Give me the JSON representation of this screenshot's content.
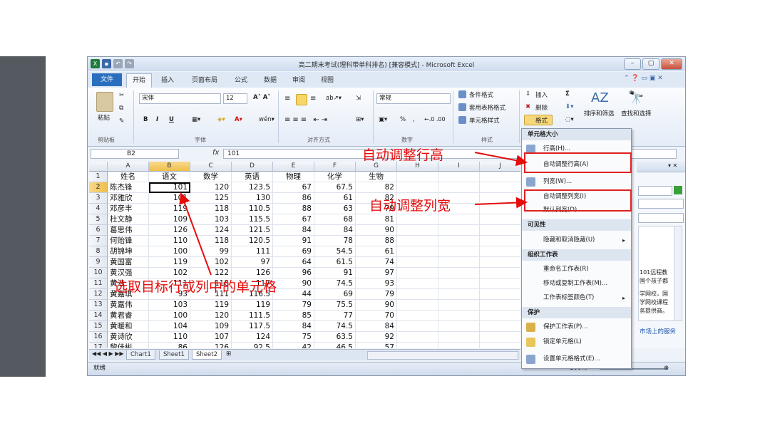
{
  "window": {
    "title": "高二期末考试(理科带单科排名) [兼容模式] - Microsoft Excel"
  },
  "tabs": [
    "文件",
    "开始",
    "插入",
    "页面布局",
    "公式",
    "数据",
    "审阅",
    "视图"
  ],
  "ribbon": {
    "clipboard": {
      "label": "剪贴板",
      "paste": "粘贴"
    },
    "font": {
      "label": "字体",
      "name": "宋体",
      "size": "12",
      "bold": "B",
      "italic": "I",
      "underline": "U"
    },
    "alignment": {
      "label": "对齐方式"
    },
    "number": {
      "label": "数字",
      "format": "常规",
      "percent": "%",
      "comma": ","
    },
    "styles": {
      "label": "样式",
      "conditional": "条件格式",
      "table": "套用表格格式",
      "cell": "单元格样式"
    },
    "cells": {
      "insert": "插入",
      "delete": "删除",
      "format": "格式"
    },
    "editing": {
      "sort": "排序和筛选",
      "find": "查找和选择",
      "sigma": "Σ"
    }
  },
  "formula_bar": {
    "name_box": "B2",
    "fx": "fx",
    "content": "101"
  },
  "columns": [
    "A",
    "B",
    "C",
    "D",
    "E",
    "F",
    "G",
    "H",
    "I",
    "J"
  ],
  "rows": [
    {
      "n": "1",
      "cells": [
        "姓名",
        "语文",
        "数学",
        "英语",
        "物理",
        "化学",
        "生物"
      ]
    },
    {
      "n": "2",
      "cells": [
        "陈杰锋",
        "101",
        "120",
        "123.5",
        "67",
        "67.5",
        "82"
      ]
    },
    {
      "n": "3",
      "cells": [
        "邓雅欣",
        "101",
        "125",
        "130",
        "86",
        "61",
        "82"
      ]
    },
    {
      "n": "4",
      "cells": [
        "邓彦丰",
        "119",
        "118",
        "110.5",
        "88",
        "63",
        "79"
      ]
    },
    {
      "n": "5",
      "cells": [
        "杜文静",
        "109",
        "103",
        "115.5",
        "67",
        "68",
        "81"
      ]
    },
    {
      "n": "6",
      "cells": [
        "葛思伟",
        "126",
        "124",
        "121.5",
        "84",
        "84",
        "90"
      ]
    },
    {
      "n": "7",
      "cells": [
        "何贻锋",
        "110",
        "118",
        "120.5",
        "91",
        "78",
        "88"
      ]
    },
    {
      "n": "8",
      "cells": [
        "胡锦坤",
        "100",
        "99",
        "111",
        "69",
        "54.5",
        "61"
      ]
    },
    {
      "n": "9",
      "cells": [
        "黄国富",
        "119",
        "102",
        "97",
        "64",
        "61.5",
        "74"
      ]
    },
    {
      "n": "10",
      "cells": [
        "黄汉强",
        "102",
        "122",
        "126",
        "96",
        "91",
        "97"
      ]
    },
    {
      "n": "11",
      "cells": [
        "黄浩",
        "111",
        "118",
        "117",
        "90",
        "74.5",
        "93"
      ]
    },
    {
      "n": "12",
      "cells": [
        "黄嘉琪",
        "93",
        "111",
        "116.5",
        "44",
        "69",
        "79"
      ]
    },
    {
      "n": "13",
      "cells": [
        "黄嘉伟",
        "103",
        "119",
        "119",
        "79",
        "75.5",
        "90"
      ]
    },
    {
      "n": "14",
      "cells": [
        "黄君睿",
        "100",
        "120",
        "111.5",
        "85",
        "77",
        "70"
      ]
    },
    {
      "n": "15",
      "cells": [
        "黄暖和",
        "104",
        "109",
        "117.5",
        "84",
        "74.5",
        "84"
      ]
    },
    {
      "n": "16",
      "cells": [
        "黄诗欣",
        "110",
        "107",
        "124",
        "75",
        "63.5",
        "92"
      ]
    },
    {
      "n": "17",
      "cells": [
        "黎佳彬",
        "86",
        "126",
        "92.5",
        "42",
        "46.5",
        "57"
      ]
    }
  ],
  "sheet_tabs": [
    "Chart1",
    "Sheet1",
    "Sheet2"
  ],
  "status": {
    "ready": "就绪",
    "zoom": "100%"
  },
  "menu": {
    "section_size": "单元格大小",
    "row_height": "行高(H)...",
    "autofit_row": "自动调整行高(A)",
    "col_width": "列宽(W)...",
    "autofit_col": "自动调整列宽(I)",
    "default_width": "默认列宽(D)...",
    "section_visibility": "可见性",
    "hide_unhide": "隐藏和取消隐藏(U)",
    "section_organize": "组织工作表",
    "rename": "重命名工作表(R)",
    "move_copy": "移动或复制工作表(M)...",
    "tab_color": "工作表标签颜色(T)",
    "section_protect": "保护",
    "protect_sheet": "保护工作表(P)...",
    "lock_cell": "锁定单元格(L)",
    "format_cells": "设置单元格格式(E)..."
  },
  "pane_text": {
    "l1": "101远程教",
    "l2": "国个孩子都",
    "l3": "学网校，国",
    "l4": "学网校课程",
    "l5": "务提供商。",
    "link": "市场上的服务"
  },
  "annotations": {
    "autofit_row": "自动调整行高",
    "autofit_col": "自动调整列宽",
    "select_cell": "选取目标行或列中的单元格"
  },
  "colors": {
    "annotation": "#e60c0c",
    "file_tab": "#2a6fbf"
  }
}
